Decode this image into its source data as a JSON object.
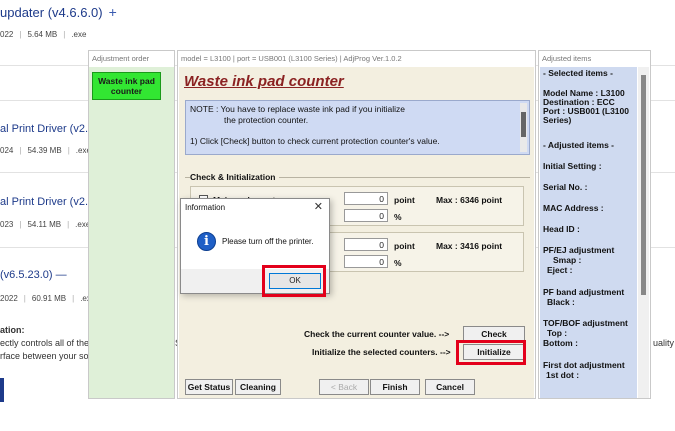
{
  "background_page": {
    "item1": {
      "title": "updater (v4.6.6.0)",
      "plus": "+",
      "date": "022",
      "size": "5.64 MB",
      "ext": ".exe"
    },
    "item2": {
      "title": "al Print Driver (v2.7",
      "date": "024",
      "size": "54.39 MB",
      "ext": ".exe"
    },
    "item3": {
      "title": "al Print Driver (v2.7",
      "date": "023",
      "size": "54.11 MB",
      "ext": ".exe"
    },
    "item4": {
      "title": "(v6.5.23.0)",
      "dash": "—",
      "date": "2022",
      "size": "60.91 MB",
      "ext": ".ex"
    },
    "desc_heading": "ation:",
    "desc_line1": "ectly controls all of the",
    "desc_line2": "rface between your so",
    "right_fragment": "uality",
    "s_fragment": "S"
  },
  "left_panel": {
    "title": "Adjustment order",
    "button_line1": "Waste ink pad",
    "button_line2": "counter"
  },
  "main_panel": {
    "title": "model = L3100 | port = USB001 (L3100 Series) | AdjProg Ver.1.0.2",
    "heading": "Waste ink pad counter",
    "note_line1": "NOTE : You have to replace waste ink pad if you initialize",
    "note_line2": "the protection counter.",
    "note_line3": "1) Click [Check] button to check current protection counter's value.",
    "section": "Check & Initialization",
    "main_counter": {
      "label": "Main pad counter",
      "point_value": "0",
      "point_unit": "point",
      "max": "Max : 6346 point",
      "percent_value": "0",
      "percent_unit": "%"
    },
    "second_counter": {
      "point_value": "0",
      "point_unit": "point",
      "max": "Max : 3416 point",
      "percent_value": "0",
      "percent_unit": "%"
    },
    "check_instruction": "Check the current counter value.  -->",
    "check_button": "Check",
    "init_instruction": "Initialize the selected counters.  -->",
    "init_button": "Initialize",
    "footer_buttons": {
      "get_status": "Get Status",
      "cleaning": "Cleaning",
      "back": "< Back",
      "finish": "Finish",
      "cancel": "Cancel"
    }
  },
  "right_panel": {
    "title": "Adjusted items",
    "selected_items": "- Selected items -",
    "model": "Model Name : L3100",
    "destination": "Destination : ECC",
    "port1": "Port : USB001 (L3100",
    "port2": "Series)",
    "adjusted_items": "- Adjusted items -",
    "initial_setting": "Initial Setting :",
    "serial_no": "Serial No. :",
    "mac_address": "MAC Address :",
    "head_id": "Head ID :",
    "pf_ej": "PF/EJ adjustment",
    "smap": "Smap :",
    "eject": "Eject :",
    "pf_band": "PF band adjustment",
    "black": "Black :",
    "tof_bof": "TOF/BOF adjustment",
    "top": "Top :",
    "bottom": "Bottom :",
    "first_dot": "First dot adjustment",
    "first_dot_val": "1st dot :"
  },
  "dialog": {
    "title": "Information",
    "close": "✕",
    "message": "Please turn off the printer.",
    "ok": "OK",
    "icon": "info-icon"
  },
  "colors": {
    "highlight": "#e3001b",
    "green_button": "#32e632",
    "note_bg": "#cfdaf3",
    "heading": "#8b2222"
  }
}
